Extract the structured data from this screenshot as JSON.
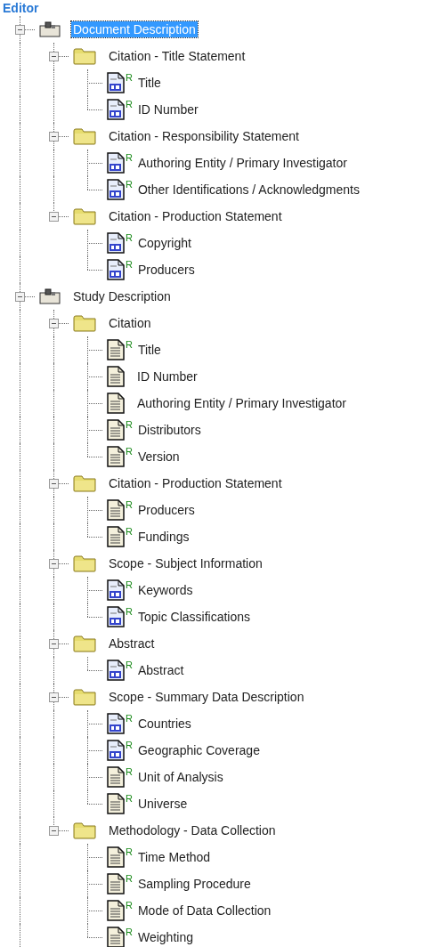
{
  "heading": "Editor",
  "tree": [
    {
      "label": "Document Description",
      "kind": "section",
      "selected": true,
      "expanded": true,
      "children": [
        {
          "label": "Citation - Title Statement",
          "kind": "folder",
          "selected": false,
          "expanded": true,
          "children": [
            {
              "label": "Title",
              "kind": "dc",
              "badge": "R",
              "selected": false
            },
            {
              "label": "ID Number",
              "kind": "dc",
              "badge": "R",
              "selected": false
            }
          ]
        },
        {
          "label": "Citation - Responsibility Statement",
          "kind": "folder",
          "selected": false,
          "expanded": true,
          "children": [
            {
              "label": "Authoring Entity / Primary Investigator",
              "kind": "dc",
              "badge": "R",
              "selected": false
            },
            {
              "label": "Other Identifications / Acknowledgments",
              "kind": "dc",
              "badge": "R",
              "selected": false
            }
          ]
        },
        {
          "label": "Citation - Production Statement",
          "kind": "folder",
          "selected": false,
          "expanded": true,
          "children": [
            {
              "label": "Copyright",
              "kind": "dc",
              "badge": "R",
              "selected": false
            },
            {
              "label": "Producers",
              "kind": "dc",
              "badge": "R",
              "selected": false
            }
          ]
        }
      ]
    },
    {
      "label": "Study Description",
      "kind": "section",
      "selected": false,
      "expanded": true,
      "children": [
        {
          "label": "Citation",
          "kind": "folder",
          "selected": false,
          "expanded": true,
          "children": [
            {
              "label": "Title",
              "kind": "doc",
              "badge": "R",
              "selected": false
            },
            {
              "label": "ID Number",
              "kind": "doc",
              "selected": false
            },
            {
              "label": "Authoring Entity / Primary Investigator",
              "kind": "doc",
              "selected": false
            },
            {
              "label": "Distributors",
              "kind": "doc",
              "badge": "R",
              "selected": false
            },
            {
              "label": "Version",
              "kind": "doc",
              "badge": "R",
              "selected": false
            }
          ]
        },
        {
          "label": "Citation - Production Statement",
          "kind": "folder",
          "selected": false,
          "expanded": true,
          "children": [
            {
              "label": "Producers",
              "kind": "doc",
              "badge": "R",
              "selected": false
            },
            {
              "label": "Fundings",
              "kind": "doc",
              "badge": "R",
              "selected": false
            }
          ]
        },
        {
          "label": "Scope - Subject Information",
          "kind": "folder",
          "selected": false,
          "expanded": true,
          "children": [
            {
              "label": "Keywords",
              "kind": "dc",
              "badge": "R",
              "selected": false
            },
            {
              "label": "Topic Classifications",
              "kind": "dc",
              "badge": "R",
              "selected": false
            }
          ]
        },
        {
          "label": "Abstract",
          "kind": "folder",
          "selected": false,
          "expanded": true,
          "children": [
            {
              "label": "Abstract",
              "kind": "dc",
              "badge": "R",
              "selected": false
            }
          ]
        },
        {
          "label": "Scope - Summary Data Description",
          "kind": "folder",
          "selected": false,
          "expanded": true,
          "children": [
            {
              "label": "Countries",
              "kind": "dc",
              "badge": "R",
              "selected": false
            },
            {
              "label": "Geographic Coverage",
              "kind": "dc",
              "badge": "R",
              "selected": false
            },
            {
              "label": "Unit of Analysis",
              "kind": "doc",
              "badge": "R",
              "selected": false
            },
            {
              "label": "Universe",
              "kind": "doc",
              "badge": "R",
              "selected": false
            }
          ]
        },
        {
          "label": "Methodology - Data Collection",
          "kind": "folder",
          "selected": false,
          "expanded": true,
          "children": [
            {
              "label": "Time Method",
              "kind": "doc",
              "badge": "R",
              "selected": false
            },
            {
              "label": "Sampling Procedure",
              "kind": "doc",
              "badge": "R",
              "selected": false
            },
            {
              "label": "Mode of Data Collection",
              "kind": "doc",
              "badge": "R",
              "selected": false
            },
            {
              "label": "Weighting",
              "kind": "doc",
              "badge": "R",
              "selected": false
            }
          ]
        }
      ]
    }
  ]
}
